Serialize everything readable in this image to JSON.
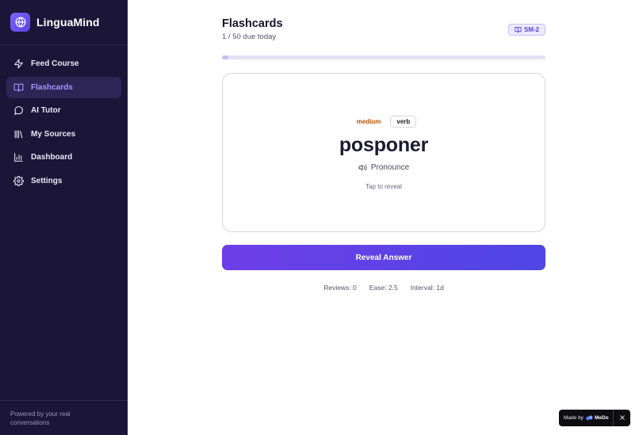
{
  "app": {
    "name": "LinguaMind",
    "logo_icon": "globe-icon"
  },
  "sidebar": {
    "items": [
      {
        "label": "Feed Course",
        "icon": "lightning-icon",
        "active": false
      },
      {
        "label": "Flashcards",
        "icon": "book-open-icon",
        "active": true
      },
      {
        "label": "AI Tutor",
        "icon": "chat-bubble-icon",
        "active": false
      },
      {
        "label": "My Sources",
        "icon": "library-icon",
        "active": false
      },
      {
        "label": "Dashboard",
        "icon": "bar-chart-icon",
        "active": false
      },
      {
        "label": "Settings",
        "icon": "gear-icon",
        "active": false
      }
    ],
    "footer": "Powered by your real conversations"
  },
  "header": {
    "title": "Flashcards",
    "subtitle": "1 / 50 due today",
    "algorithm_badge": "SM-2"
  },
  "progress": {
    "current": 1,
    "total": 50
  },
  "card": {
    "difficulty": "medium",
    "part_of_speech": "verb",
    "word": "posponer",
    "pronounce_label": "Pronounce",
    "hint": "Tap to reveal"
  },
  "actions": {
    "reveal_label": "Reveal Answer"
  },
  "stats": {
    "reviews": "Reviews: 0",
    "ease": "Ease: 2.5",
    "interval": "Interval: 1d"
  },
  "badge": {
    "made_by": "Made by",
    "brand": "MeDo"
  },
  "colors": {
    "sidebar_bg": "#1b1638",
    "accent": "#6d3ee8",
    "active_label": "#a794ff",
    "difficulty_medium": "#b45309"
  }
}
